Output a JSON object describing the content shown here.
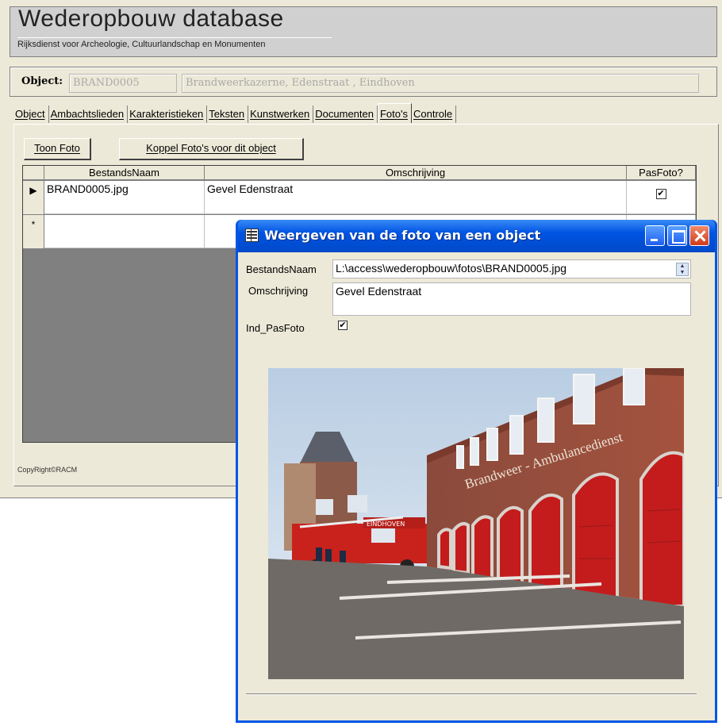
{
  "app": {
    "title": "Wederopbouw database",
    "subtitle": "Rijksdienst voor Archeologie, Cultuurlandschap en Monumenten"
  },
  "object": {
    "label": "Object:",
    "code": "BRAND0005",
    "description": "Brandweerkazerne, Edenstraat , Eindhoven"
  },
  "tabs": [
    {
      "label": "Object"
    },
    {
      "label": "Ambachtslieden"
    },
    {
      "label": "Karakteristieken"
    },
    {
      "label": "Teksten"
    },
    {
      "label": "Kunstwerken"
    },
    {
      "label": "Documenten"
    },
    {
      "label": "Foto's",
      "active": true
    },
    {
      "label": "Controle"
    }
  ],
  "buttons": {
    "show_photo": "Toon Foto",
    "link_photos": "Koppel Foto's voor dit object"
  },
  "grid": {
    "columns": [
      "BestandsNaam",
      "Omschrijving",
      "PasFoto?"
    ],
    "rows": [
      {
        "selector": "▶",
        "filename": "BRAND0005.jpg",
        "description": "Gevel Edenstraat",
        "pasfoto": true
      }
    ],
    "new_row_marker": "*"
  },
  "footer": {
    "copyright": "CopyRight©RACM"
  },
  "popup": {
    "title": "Weergeven van de foto van een object",
    "filename_label": "BestandsNaam",
    "filename_value": "L:\\access\\wederopbouw\\fotos\\BRAND0005.jpg",
    "description_label": "Omschrijving",
    "description_value": "Gevel Edenstraat",
    "pasfoto_label": "Ind_PasFoto",
    "pasfoto_checked": true,
    "photo_sign_text": "Brandweer - Ambulancedienst",
    "truck_text": "EINDHOVEN"
  },
  "colors": {
    "xp_blue": "#0055e5",
    "form_bg": "#ece9d8",
    "brick": "#9a4a36",
    "door_red": "#c41c1c"
  }
}
